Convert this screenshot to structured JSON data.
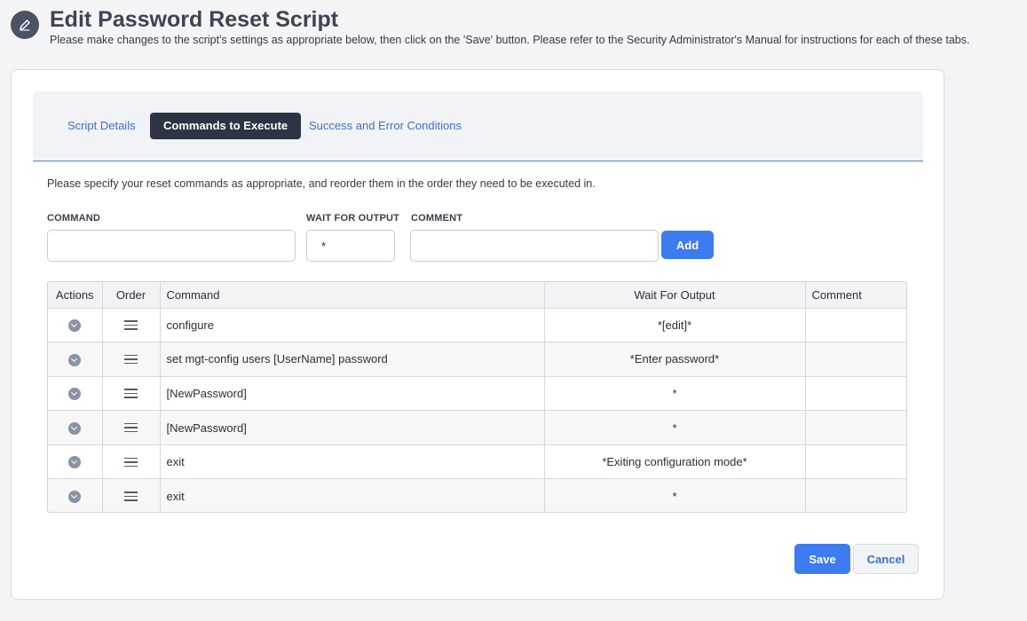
{
  "header": {
    "icon": "pencil-icon",
    "title": "Edit Password Reset Script",
    "subtitle": "Please make changes to the script's settings as appropriate below, then click on the 'Save' button. Please refer to the Security Administrator's Manual for instructions for each of these tabs."
  },
  "tabs": [
    {
      "label": "Script Details",
      "active": false
    },
    {
      "label": "Commands to Execute",
      "active": true
    },
    {
      "label": "Success and Error Conditions",
      "active": false
    }
  ],
  "instructions": "Please specify your reset commands as appropriate, and reorder them in the order they need to be executed in.",
  "form": {
    "command_label": "COMMAND",
    "command_value": "",
    "wait_label": "WAIT FOR OUTPUT",
    "wait_value": "*",
    "comment_label": "COMMENT",
    "comment_value": "",
    "add_label": "Add"
  },
  "table": {
    "headers": {
      "actions": "Actions",
      "order": "Order",
      "command": "Command",
      "wait": "Wait For Output",
      "comment": "Comment"
    },
    "rows": [
      {
        "command": "configure",
        "wait": "*[edit]*",
        "comment": ""
      },
      {
        "command": "set mgt-config users [UserName] password",
        "wait": "*Enter password*",
        "comment": ""
      },
      {
        "command": "[NewPassword]",
        "wait": "*",
        "comment": ""
      },
      {
        "command": "[NewPassword]",
        "wait": "*",
        "comment": ""
      },
      {
        "command": "exit",
        "wait": "*Exiting configuration mode*",
        "comment": ""
      },
      {
        "command": "exit",
        "wait": "*",
        "comment": ""
      }
    ]
  },
  "footer": {
    "save_label": "Save",
    "cancel_label": "Cancel"
  },
  "colors": {
    "accent": "#3d7bf0",
    "active_tab": "#2d3443",
    "link": "#3a6fd8"
  }
}
